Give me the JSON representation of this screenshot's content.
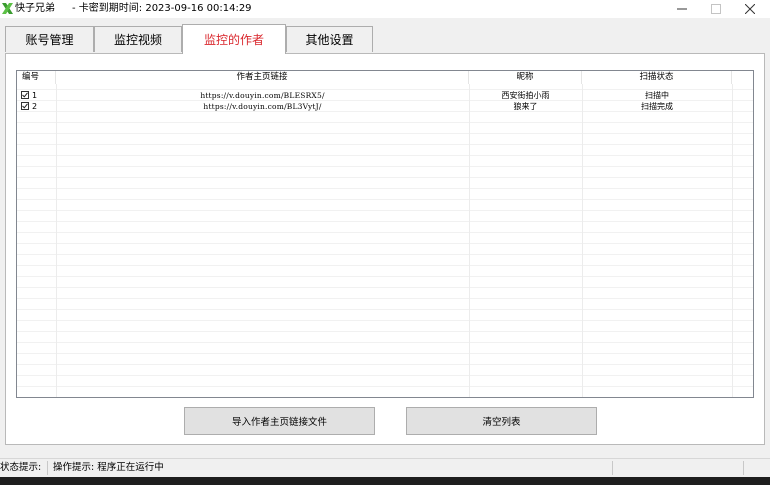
{
  "window": {
    "title": "快子兄弟",
    "expiry_text": "-    卡密到期时间: 2023-09-16 00:14:29",
    "accent_color": "#d9262c"
  },
  "tabs": [
    {
      "label": "账号管理",
      "active": false
    },
    {
      "label": "监控视频",
      "active": false
    },
    {
      "label": "监控的作者",
      "active": true
    },
    {
      "label": "其他设置",
      "active": false
    }
  ],
  "table": {
    "columns": [
      "编号",
      "作者主页链接",
      "昵称",
      "扫描状态"
    ],
    "rows": [
      {
        "checked": true,
        "id": "1",
        "url": "https://v.douyin.com/BLESRX5/",
        "nickname": "西安街拍小雨",
        "status": "扫描中"
      },
      {
        "checked": true,
        "id": "2",
        "url": "https://v.douyin.com/BL3VytJ/",
        "nickname": "狼来了",
        "status": "扫描完成"
      }
    ]
  },
  "buttons": {
    "import_label": "导入作者主页链接文件",
    "clear_label": "清空列表"
  },
  "statusbar": {
    "label": "状态提示:",
    "message": "操作提示: 程序正在运行中"
  }
}
